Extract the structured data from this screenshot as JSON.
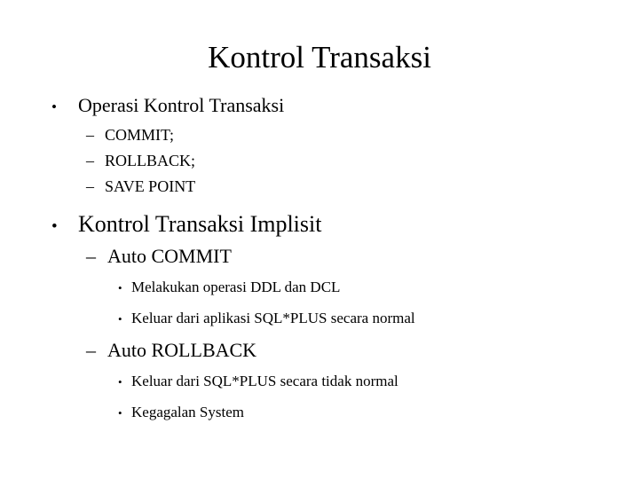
{
  "slide": {
    "title": "Kontrol Transaksi",
    "background_color": "#ffffff",
    "text_color": "#000000",
    "bullets": {
      "level1_glyph": "•",
      "level2_glyph": "–",
      "level3_glyph": "•"
    },
    "sections": [
      {
        "heading": "Operasi Kontrol Transaksi",
        "items": [
          {
            "text": "COMMIT;"
          },
          {
            "text": "ROLLBACK;"
          },
          {
            "text": "SAVE POINT"
          }
        ]
      },
      {
        "heading": "Kontrol Transaksi Implisit",
        "items": [
          {
            "text": "Auto COMMIT",
            "subitems": [
              {
                "text": "Melakukan operasi DDL dan DCL"
              },
              {
                "text": "Keluar dari aplikasi SQL*PLUS secara normal"
              }
            ]
          },
          {
            "text": "Auto ROLLBACK",
            "subitems": [
              {
                "text": "Keluar dari SQL*PLUS secara tidak normal"
              },
              {
                "text": "Kegagalan System"
              }
            ]
          }
        ]
      }
    ]
  }
}
